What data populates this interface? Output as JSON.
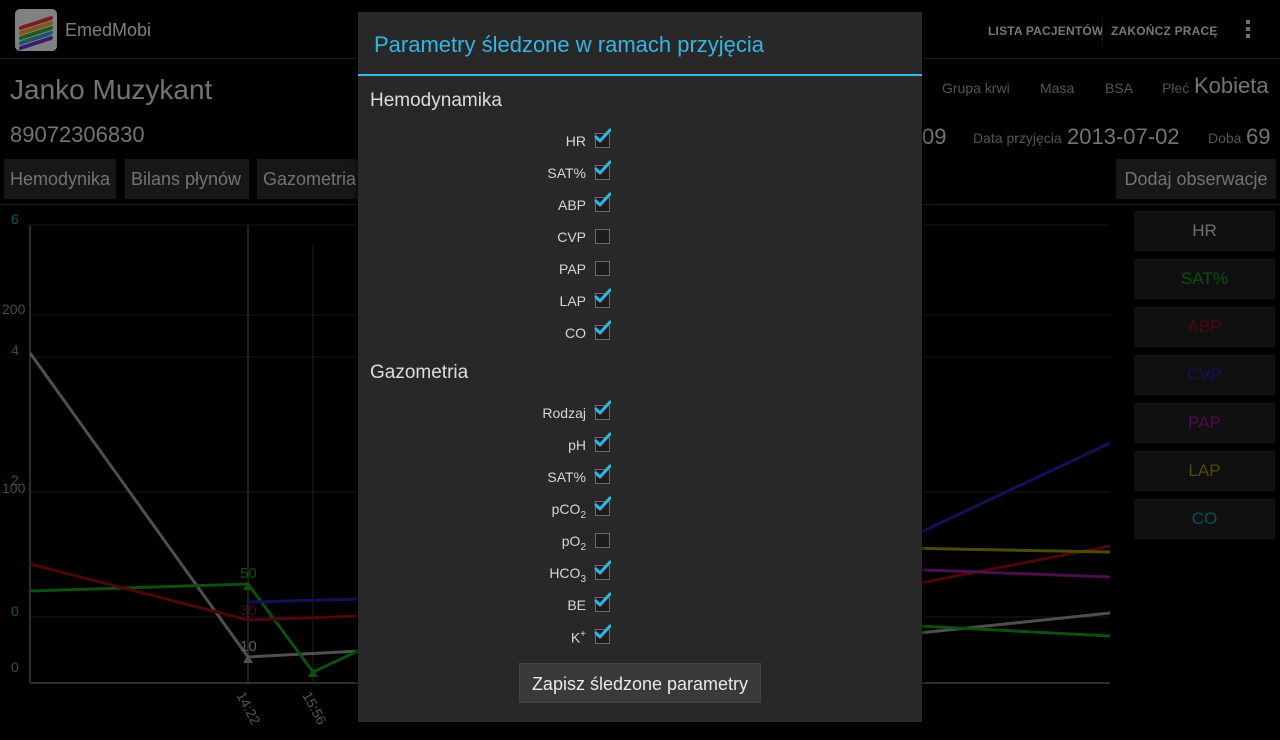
{
  "app": {
    "name": "EmedMobi",
    "actions": {
      "patients": "LISTA PACJENTÓW",
      "end_work": "ZAKOŃCZ PRACĘ"
    }
  },
  "patient": {
    "name": "Janko Muzykant",
    "id": "89072306830",
    "blood_group_label": "Grupa krwi",
    "mass_label": "Masa",
    "bsa_label": "BSA",
    "sex_label": "Płeć",
    "sex_value": "Kobieta",
    "partial_value": "09",
    "admission_label": "Data przyjęcia",
    "admission_value": "2013-07-02",
    "day_label": "Doba",
    "day_value": "69"
  },
  "tabs": [
    "Hemodynika",
    "Bilans płynów",
    "Gazometria"
  ],
  "add_observation": "Dodaj obserwacje",
  "legend": [
    {
      "label": "HR",
      "color": "#cccccc"
    },
    {
      "label": "SAT%",
      "color": "#1a8f1a"
    },
    {
      "label": "ABP",
      "color": "#8b1010"
    },
    {
      "label": "CVP",
      "color": "#2020a0"
    },
    {
      "label": "PAP",
      "color": "#8a1a8a"
    },
    {
      "label": "LAP",
      "color": "#8a8a10"
    },
    {
      "label": "CO",
      "color": "#10909a"
    }
  ],
  "chart_data": {
    "type": "line",
    "y_ticks_cyan": [
      "6",
      "4",
      "2",
      "0"
    ],
    "y_ticks_white": [
      "200",
      "100",
      "0"
    ],
    "x_ticks": [
      "14:22",
      "15:56"
    ],
    "point_labels": [
      {
        "text": "50",
        "color": "#1a8f1a"
      },
      {
        "text": "30",
        "color": "#8b1010"
      },
      {
        "text": "10",
        "color": "#aaaaaa"
      }
    ]
  },
  "dialog": {
    "title": "Parametry śledzone w ramach przyjęcia",
    "sections": [
      {
        "title": "Hemodynamika",
        "items": [
          {
            "label": "HR",
            "checked": true
          },
          {
            "label": "SAT%",
            "checked": true
          },
          {
            "label": "ABP",
            "checked": true
          },
          {
            "label": "CVP",
            "checked": false
          },
          {
            "label": "PAP",
            "checked": false
          },
          {
            "label": "LAP",
            "checked": true
          },
          {
            "label": "CO",
            "checked": true
          }
        ]
      },
      {
        "title": "Gazometria",
        "items": [
          {
            "label": "Rodzaj",
            "checked": true
          },
          {
            "label": "pH",
            "checked": true
          },
          {
            "label": "SAT%",
            "checked": true
          },
          {
            "label": "pCO",
            "sub": "2",
            "checked": true
          },
          {
            "label": "pO",
            "sub": "2",
            "checked": false
          },
          {
            "label": "HCO",
            "sub": "3",
            "checked": true
          },
          {
            "label": "BE",
            "checked": true
          },
          {
            "label": "K",
            "sup": "+",
            "checked": true
          }
        ]
      }
    ],
    "save_label": "Zapisz śledzone parametry"
  }
}
